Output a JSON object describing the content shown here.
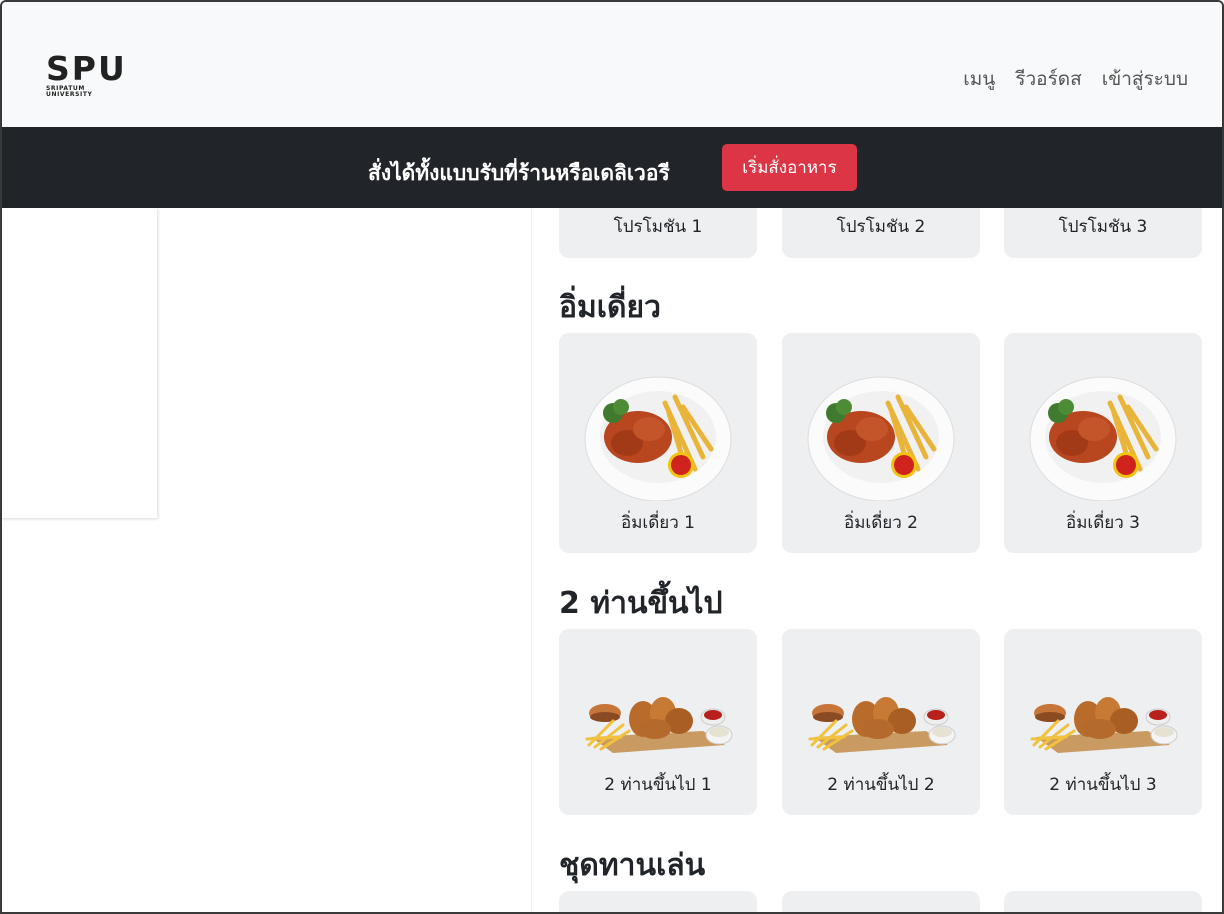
{
  "navbar": {
    "logo": {
      "main": "SPU",
      "sub1": "SRIPATUM",
      "sub2": "UNIVERSITY"
    },
    "links": [
      "เมนู",
      "รีวอร์ดส",
      "เข้าสู่ระบบ"
    ]
  },
  "banner": {
    "text": "สั่งได้ทั้งแบบรับที่ร้านหรือเดลิเวอรี",
    "button": "เริ่มสั่งอาหาร"
  },
  "sections": {
    "promo": {
      "items": [
        "โปรโมชัน 1",
        "โปรโมชัน 2",
        "โปรโมชัน 3"
      ]
    },
    "single": {
      "title": "อิ่มเดี่ยว",
      "items": [
        "อิ่มเดี่ยว 1",
        "อิ่มเดี่ยว 2",
        "อิ่มเดี่ยว 3"
      ]
    },
    "group": {
      "title": "2 ท่านขึ้นไป",
      "items": [
        "2 ท่านขึ้นไป 1",
        "2 ท่านขึ้นไป 2",
        "2 ท่านขึ้นไป 3"
      ]
    },
    "snack": {
      "title": "ชุดทานเล่น"
    }
  },
  "colors": {
    "accent": "#dc3545",
    "banner": "#212529",
    "card": "#edeff0"
  }
}
